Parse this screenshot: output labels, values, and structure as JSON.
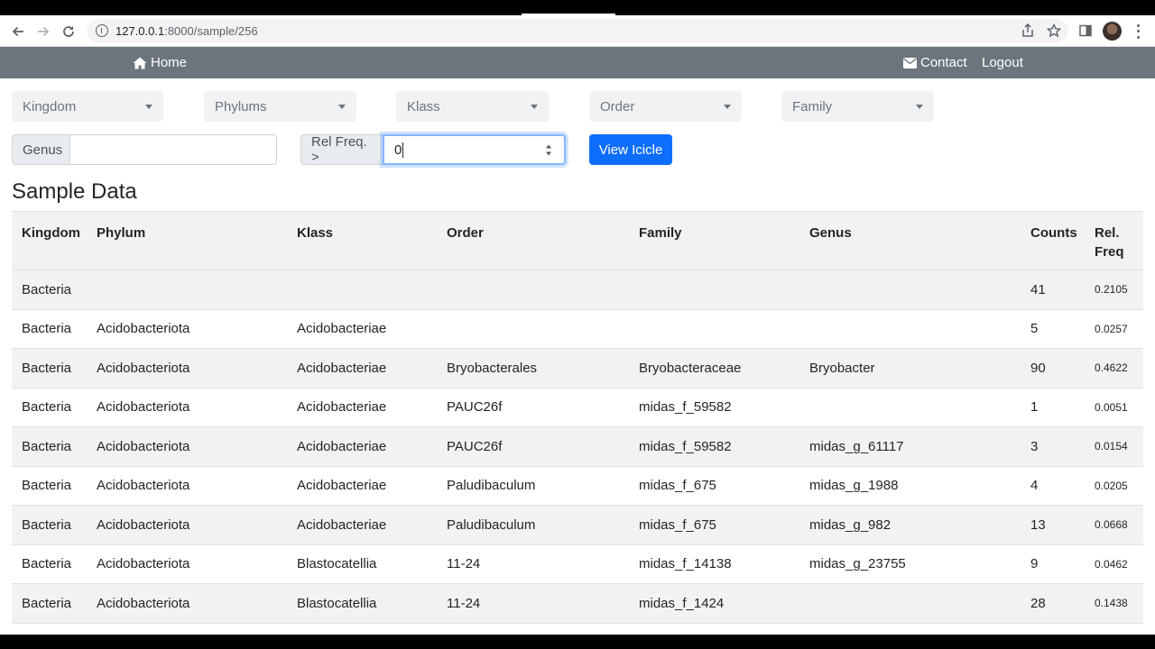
{
  "browser": {
    "url_host": "127.0.0.1",
    "url_path": ":8000/sample/256"
  },
  "navbar": {
    "home_label": "Home",
    "contact_label": "Contact",
    "logout_label": "Logout"
  },
  "filters": {
    "kingdom": "Kingdom",
    "phylums": "Phylums",
    "klass": "Klass",
    "order": "Order",
    "family": "Family",
    "genus_label": "Genus",
    "genus_value": "",
    "relfreq_label": "Rel Freq. >",
    "relfreq_value": "0",
    "view_button": "View Icicle"
  },
  "page_title": "Sample Data",
  "table": {
    "headers": {
      "kingdom": "Kingdom",
      "phylum": "Phylum",
      "klass": "Klass",
      "order": "Order",
      "family": "Family",
      "genus": "Genus",
      "counts": "Counts",
      "freq_line1": "Rel.",
      "freq_line2": "Freq"
    },
    "rows": [
      {
        "kingdom": "Bacteria",
        "phylum": "",
        "klass": "",
        "order": "",
        "family": "",
        "genus": "",
        "counts": "41",
        "freq": "0.2105"
      },
      {
        "kingdom": "Bacteria",
        "phylum": "Acidobacteriota",
        "klass": "Acidobacteriae",
        "order": "",
        "family": "",
        "genus": "",
        "counts": "5",
        "freq": "0.0257"
      },
      {
        "kingdom": "Bacteria",
        "phylum": "Acidobacteriota",
        "klass": "Acidobacteriae",
        "order": "Bryobacterales",
        "family": "Bryobacteraceae",
        "genus": "Bryobacter",
        "counts": "90",
        "freq": "0.4622"
      },
      {
        "kingdom": "Bacteria",
        "phylum": "Acidobacteriota",
        "klass": "Acidobacteriae",
        "order": "PAUC26f",
        "family": "midas_f_59582",
        "genus": "",
        "counts": "1",
        "freq": "0.0051"
      },
      {
        "kingdom": "Bacteria",
        "phylum": "Acidobacteriota",
        "klass": "Acidobacteriae",
        "order": "PAUC26f",
        "family": "midas_f_59582",
        "genus": "midas_g_61117",
        "counts": "3",
        "freq": "0.0154"
      },
      {
        "kingdom": "Bacteria",
        "phylum": "Acidobacteriota",
        "klass": "Acidobacteriae",
        "order": "Paludibaculum",
        "family": "midas_f_675",
        "genus": "midas_g_1988",
        "counts": "4",
        "freq": "0.0205"
      },
      {
        "kingdom": "Bacteria",
        "phylum": "Acidobacteriota",
        "klass": "Acidobacteriae",
        "order": "Paludibaculum",
        "family": "midas_f_675",
        "genus": "midas_g_982",
        "counts": "13",
        "freq": "0.0668"
      },
      {
        "kingdom": "Bacteria",
        "phylum": "Acidobacteriota",
        "klass": "Blastocatellia",
        "order": "11-24",
        "family": "midas_f_14138",
        "genus": "midas_g_23755",
        "counts": "9",
        "freq": "0.0462"
      },
      {
        "kingdom": "Bacteria",
        "phylum": "Acidobacteriota",
        "klass": "Blastocatellia",
        "order": "11-24",
        "family": "midas_f_1424",
        "genus": "",
        "counts": "28",
        "freq": "0.1438"
      }
    ]
  }
}
